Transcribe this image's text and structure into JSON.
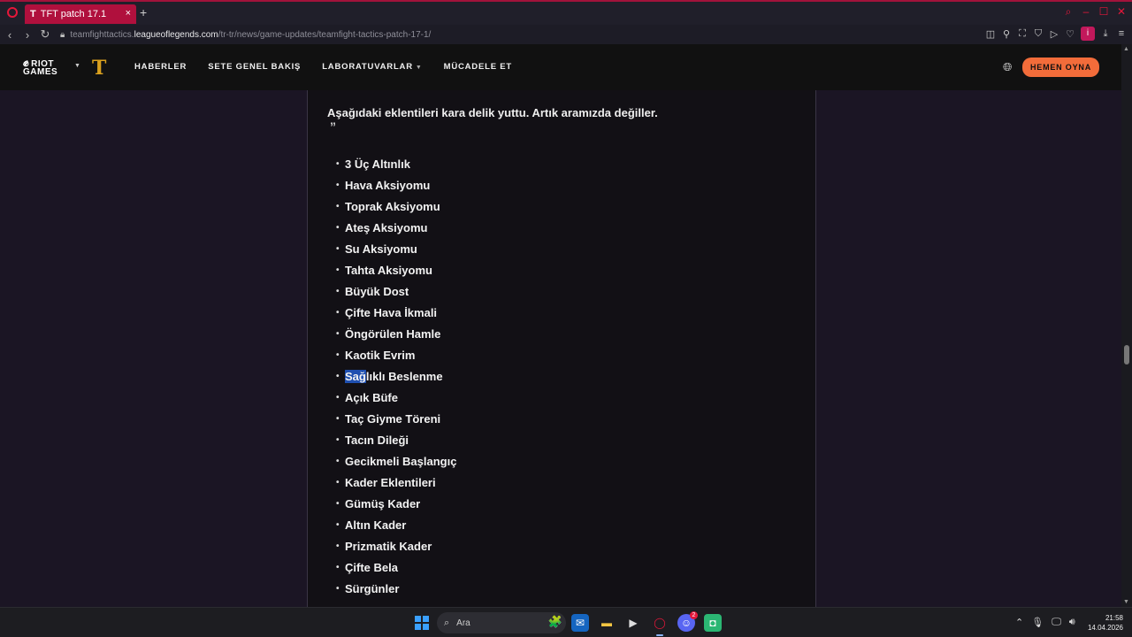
{
  "browser": {
    "tab_title": "TFT patch 17.1",
    "tab_icon": "T",
    "tab_close": "×",
    "new_tab": "+",
    "url_prefix": "teamfighttactics.",
    "url_domain": "leagueoflegends.com",
    "url_path": "/tr-tr/news/game-updates/teamfight-tactics-patch-17-1/",
    "profile_initial": "i"
  },
  "site_nav": {
    "riot_logo_line1": "RIOT",
    "riot_logo_line2": "GAMES",
    "tft_logo": "T",
    "links": [
      "HABERLER",
      "SETE GENEL BAKIŞ",
      "LABORATUVARLAR",
      "MÜCADELE ET"
    ],
    "play_button": "HEMEN OYNA"
  },
  "article": {
    "quote": "Aşağıdaki eklentileri kara delik yuttu. Artık aramızda değiller.",
    "quote_mark": "”",
    "items": [
      "3 Üç Altınlık",
      "Hava Aksiyomu",
      "Toprak Aksiyomu",
      "Ateş Aksiyomu",
      "Su Aksiyomu",
      "Tahta Aksiyomu",
      "Büyük Dost",
      "Çifte Hava İkmali",
      "Öngörülen Hamle",
      "Kaotik Evrim",
      "Sağlıklı Beslenme",
      "Açık Büfe",
      "Taç Giyme Töreni",
      "Tacın Dileği",
      "Gecikmeli Başlangıç",
      "Kader Eklentileri",
      "Gümüş Kader",
      "Altın Kader",
      "Prizmatik Kader",
      "Çifte Bela",
      "Sürgünler"
    ],
    "selected_part": "Sağ",
    "selected_rest": "lıklı Beslenme"
  },
  "taskbar": {
    "search_placeholder": "Ara",
    "discord_badge": "2",
    "time": "21:58",
    "date": "14.04.2026"
  },
  "colors": {
    "accent": "#b0103d",
    "play_button": "#f26c3a",
    "tft_gold": "#d9a01e",
    "selection": "#1f4fb0"
  }
}
